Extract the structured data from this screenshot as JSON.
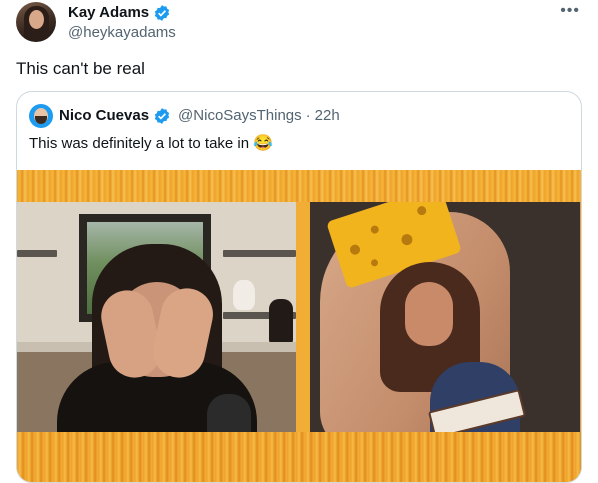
{
  "tweet": {
    "author_name": "Kay Adams",
    "author_handle": "@heykayadams",
    "more_icon": "more-horizontal-icon",
    "text": "This can't be real"
  },
  "quote": {
    "author_name": "Nico Cuevas",
    "author_handle": "@NicoSaysThings",
    "separator": "·",
    "time": "22h",
    "text": "This was definitely a lot to take in",
    "emoji": "😂"
  },
  "colors": {
    "verified": "#1d9bf0",
    "text_primary": "#0f1419",
    "text_secondary": "#536471",
    "border": "#cfd9de",
    "frame_orange": "#f0a52b"
  },
  "icons": {
    "verified": "verified-badge-icon",
    "more": "more-horizontal-icon"
  }
}
